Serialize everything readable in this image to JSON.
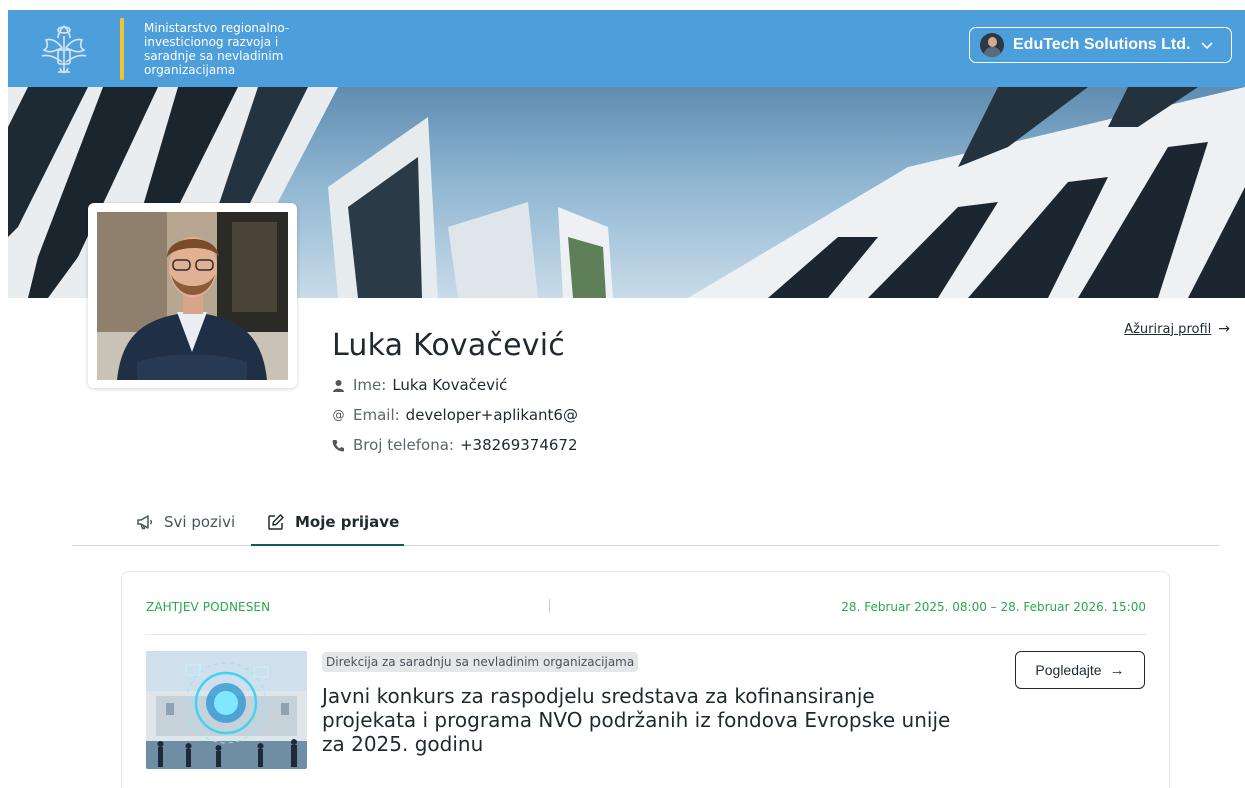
{
  "header": {
    "ministry_name": "Ministarstvo regionalno-investicionog razvoja i saradnje sa nevladinim organizacijama",
    "organization": "EduTech Solutions Ltd.",
    "coat_icon": "coat-of-arms-icon",
    "chevron_icon": "chevron-down-icon"
  },
  "profile": {
    "full_name": "Luka Kovačević",
    "name_label": "Ime:",
    "name_value": "Luka Kovačević",
    "email_label": "Email:",
    "email_value": "developer+aplikant6@",
    "phone_label": "Broj telefona:",
    "phone_value": "+38269374672",
    "update_link": "Ažuriraj profil"
  },
  "tabs": [
    {
      "label": "Svi pozivi",
      "icon": "megaphone-icon",
      "active": false
    },
    {
      "label": "Moje prijave",
      "icon": "edit-icon",
      "active": true
    }
  ],
  "application": {
    "status": "ZAHTJEV PODNESEN",
    "period": "28. Februar 2025. 08:00 – 28. Februar 2026. 15:00",
    "department": "Direkcija za saradnju sa nevladinim organizacijama",
    "title": "Javni konkurs za raspodjelu sredstava za kofinansiranje projekata i programa NVO podržanih iz fondova Evropske unije za 2025. godinu",
    "view_button": "Pogledajte"
  },
  "colors": {
    "header_bg": "#4d9fdc",
    "accent_gold": "#f2c230",
    "status_green": "#2aa84a",
    "tab_underline": "#0d5a6b"
  }
}
